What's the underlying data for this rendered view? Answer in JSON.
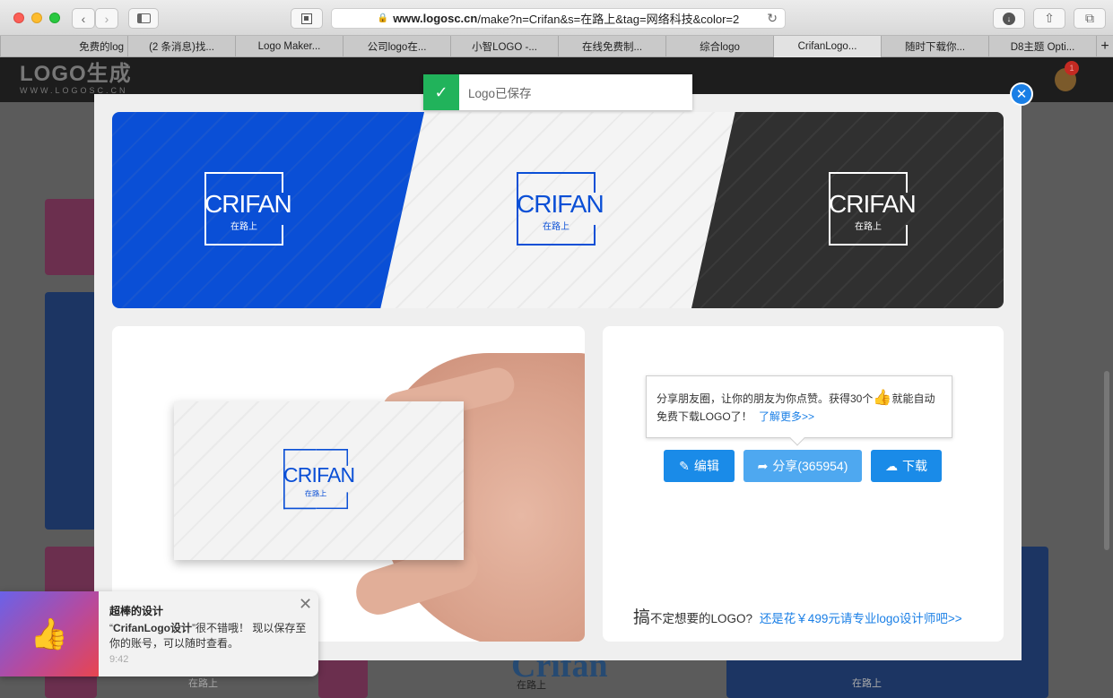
{
  "browser": {
    "url_host": "www.logosc.cn",
    "url_path": "/make?n=Crifan&s=在路上&tag=网络科技&color=2",
    "tabs": [
      "免费的log",
      "(2 条消息)找...",
      "Logo Maker...",
      "公司logo在...",
      "小智LOGO -...",
      "在线免费制...",
      "综合logo",
      "CrifanLogo...",
      "随时下载你...",
      "D8主题 Opti..."
    ],
    "active_tab_index": 7,
    "new_tab_label": "+"
  },
  "site": {
    "logo_main": "LOGO生成",
    "logo_sub": "WWW.LOGOSC.CN",
    "badge_count": "1"
  },
  "toast": {
    "message": "Logo已保存"
  },
  "logo": {
    "name": "CRIFAN",
    "slogan": "在路上",
    "watermark": "WWW.LOGOSC.CN"
  },
  "colors": {
    "blue": "#0a4fd6",
    "dark": "#303030",
    "button": "#1a8be8",
    "share_button": "#4ea8f0",
    "success": "#21b35b"
  },
  "share_tip": {
    "line1_a": "分享朋友圈，让你的朋友为你点赞。获得30个",
    "line1_b": "就能自动",
    "line2": "免费下载LOGO了！",
    "learn_more": "了解更多>>"
  },
  "buttons": {
    "edit": "编辑",
    "share": "分享(365954)",
    "download": "下载"
  },
  "bottom": {
    "big_char": "搞",
    "text": "不定想要的LOGO?",
    "link": "还是花￥499元请专业logo设计师吧>>"
  },
  "notification": {
    "title": "超棒的设计",
    "body_quote_open": "“",
    "body_bold": "CrifanLogo设计",
    "body_rest": "”很不错哦！ 现以保存至你的账号，可以随时查看。",
    "time": "9:42"
  },
  "background_text": {
    "brand": "Crifan",
    "slogan": "在路上"
  }
}
